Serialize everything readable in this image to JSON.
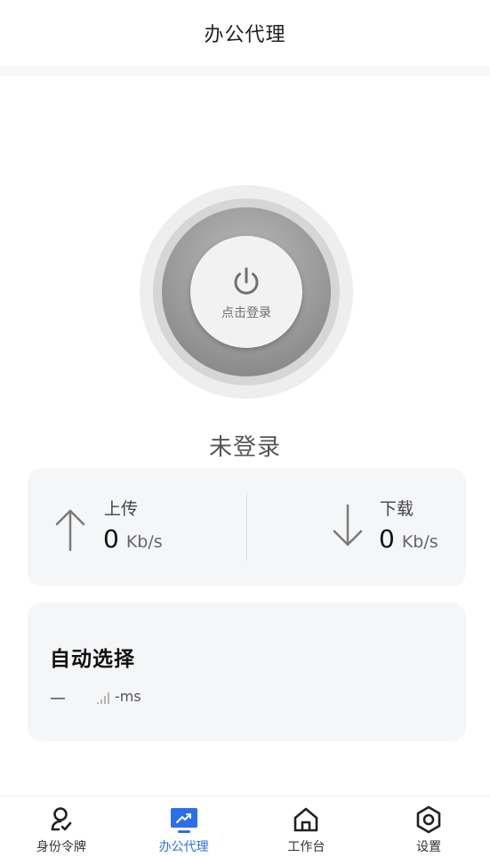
{
  "header": {
    "title": "办公代理"
  },
  "power": {
    "label": "点击登录"
  },
  "status": {
    "text": "未登录"
  },
  "speed": {
    "upload": {
      "label": "上传",
      "value": "0",
      "unit": "Kb/s"
    },
    "download": {
      "label": "下载",
      "value": "0",
      "unit": "Kb/s"
    }
  },
  "proxy": {
    "title": "自动选择",
    "dash": "—",
    "latency": "-ms"
  },
  "tabs": [
    {
      "label": "身份令牌",
      "icon": "user-check-icon",
      "active": false
    },
    {
      "label": "办公代理",
      "icon": "trend-chart-icon",
      "active": true
    },
    {
      "label": "工作台",
      "icon": "home-icon",
      "active": false
    },
    {
      "label": "设置",
      "icon": "gear-icon",
      "active": false
    }
  ],
  "colors": {
    "accent": "#2c6ee8",
    "card": "#f5f6f8"
  }
}
